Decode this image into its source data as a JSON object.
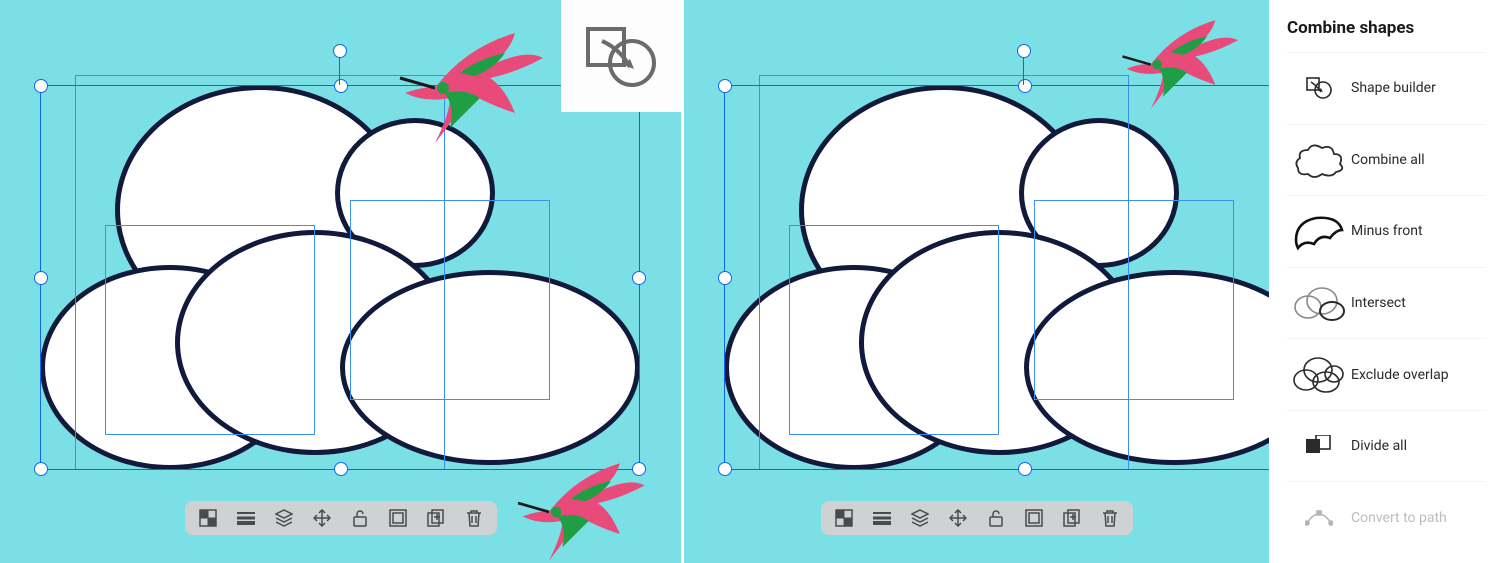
{
  "canvas": {
    "bg": "#7be0e5",
    "shape_fill": "#ffffff",
    "shape_stroke": "#111a3b"
  },
  "contextual_toolbar": {
    "items": [
      {
        "name": "transparency-icon"
      },
      {
        "name": "stroke-icon"
      },
      {
        "name": "layers-icon"
      },
      {
        "name": "move-icon"
      },
      {
        "name": "unlock-icon"
      },
      {
        "name": "group-icon"
      },
      {
        "name": "duplicate-icon"
      },
      {
        "name": "delete-icon"
      }
    ]
  },
  "callout": {
    "name": "shape-builder-icon"
  },
  "panel": {
    "title": "Combine shapes",
    "items": [
      {
        "name": "shape-builder",
        "label": "Shape builder",
        "enabled": true
      },
      {
        "name": "combine-all",
        "label": "Combine all",
        "enabled": true
      },
      {
        "name": "minus-front",
        "label": "Minus front",
        "enabled": true
      },
      {
        "name": "intersect",
        "label": "Intersect",
        "enabled": true
      },
      {
        "name": "exclude-overlap",
        "label": "Exclude overlap",
        "enabled": true
      },
      {
        "name": "divide-all",
        "label": "Divide all",
        "enabled": true
      },
      {
        "name": "convert-to-path",
        "label": "Convert to path",
        "enabled": false
      }
    ]
  }
}
